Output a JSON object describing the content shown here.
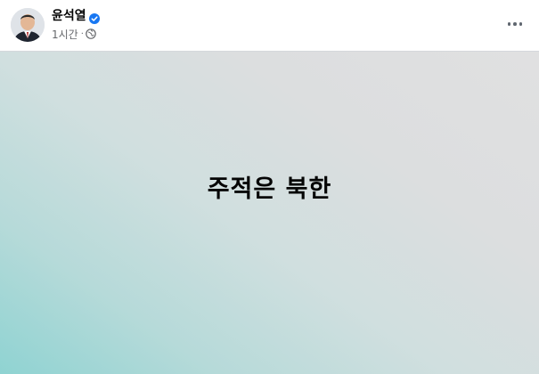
{
  "post": {
    "author": "윤석열",
    "verified_icon": "verified-badge-icon",
    "timestamp": "1시간",
    "separator": "·",
    "audience_icon": "globe-icon",
    "more_icon": "more-options-icon",
    "text": "주적은 북한",
    "colors": {
      "verified": "#1877f2",
      "background_start": "#8fd3d2",
      "background_end": "#e0e0e1"
    }
  }
}
